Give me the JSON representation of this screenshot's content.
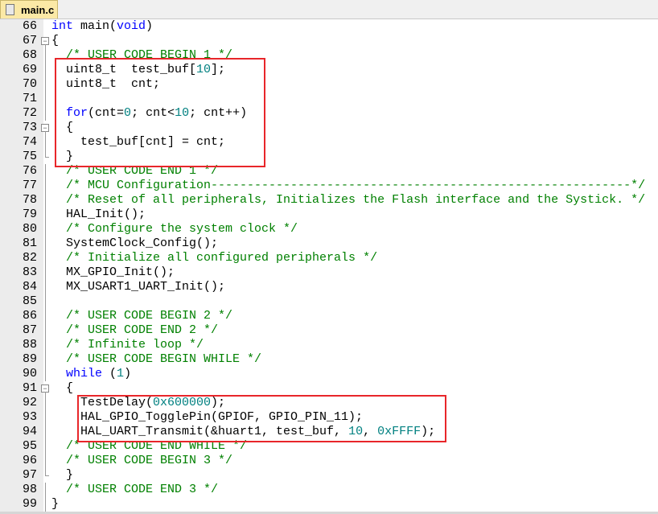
{
  "tab": {
    "title": "main.c",
    "icon": "c-file-icon"
  },
  "colors": {
    "keyword": "#0000ff",
    "comment": "#008000",
    "number": "#008080",
    "highlight_box": "#e8262a"
  },
  "lines": [
    {
      "n": "66",
      "fold": "",
      "t": [
        [
          "kw",
          "int"
        ],
        [
          "pl",
          " main("
        ],
        [
          "kw",
          "void"
        ],
        [
          "pl",
          ")"
        ]
      ]
    },
    {
      "n": "67",
      "fold": "open",
      "t": [
        [
          "pl",
          "{"
        ]
      ]
    },
    {
      "n": "68",
      "fold": "v",
      "t": [
        [
          "cm",
          "  /* USER CODE BEGIN 1 */"
        ]
      ]
    },
    {
      "n": "69",
      "fold": "v",
      "t": [
        [
          "pl",
          "  uint8_t  test_buf["
        ],
        [
          "num",
          "10"
        ],
        [
          "pl",
          "];"
        ]
      ]
    },
    {
      "n": "70",
      "fold": "v",
      "t": [
        [
          "pl",
          "  uint8_t  cnt;"
        ]
      ]
    },
    {
      "n": "71",
      "fold": "v",
      "t": [
        [
          "pl",
          ""
        ]
      ]
    },
    {
      "n": "72",
      "fold": "v",
      "t": [
        [
          "pl",
          "  "
        ],
        [
          "kw",
          "for"
        ],
        [
          "pl",
          "(cnt="
        ],
        [
          "num",
          "0"
        ],
        [
          "pl",
          "; cnt<"
        ],
        [
          "num",
          "10"
        ],
        [
          "pl",
          "; cnt++)"
        ]
      ]
    },
    {
      "n": "73",
      "fold": "open",
      "t": [
        [
          "pl",
          "  {"
        ]
      ]
    },
    {
      "n": "74",
      "fold": "v",
      "t": [
        [
          "pl",
          "    test_buf[cnt] = cnt;"
        ]
      ]
    },
    {
      "n": "75",
      "fold": "end",
      "t": [
        [
          "pl",
          "  }"
        ]
      ]
    },
    {
      "n": "76",
      "fold": "v",
      "t": [
        [
          "cm",
          "  /* USER CODE END 1 */"
        ]
      ]
    },
    {
      "n": "77",
      "fold": "v",
      "t": [
        [
          "cm",
          "  /* MCU Configuration----------------------------------------------------------*/"
        ]
      ]
    },
    {
      "n": "78",
      "fold": "v",
      "t": [
        [
          "cm",
          "  /* Reset of all peripherals, Initializes the Flash interface and the Systick. */"
        ]
      ]
    },
    {
      "n": "79",
      "fold": "v",
      "t": [
        [
          "pl",
          "  HAL_Init();"
        ]
      ]
    },
    {
      "n": "80",
      "fold": "v",
      "t": [
        [
          "cm",
          "  /* Configure the system clock */"
        ]
      ]
    },
    {
      "n": "81",
      "fold": "v",
      "t": [
        [
          "pl",
          "  SystemClock_Config();"
        ]
      ]
    },
    {
      "n": "82",
      "fold": "v",
      "t": [
        [
          "cm",
          "  /* Initialize all configured peripherals */"
        ]
      ]
    },
    {
      "n": "83",
      "fold": "v",
      "t": [
        [
          "pl",
          "  MX_GPIO_Init();"
        ]
      ]
    },
    {
      "n": "84",
      "fold": "v",
      "t": [
        [
          "pl",
          "  MX_USART1_UART_Init();"
        ]
      ]
    },
    {
      "n": "85",
      "fold": "v",
      "t": [
        [
          "pl",
          ""
        ]
      ]
    },
    {
      "n": "86",
      "fold": "v",
      "t": [
        [
          "cm",
          "  /* USER CODE BEGIN 2 */"
        ]
      ]
    },
    {
      "n": "87",
      "fold": "v",
      "t": [
        [
          "cm",
          "  /* USER CODE END 2 */"
        ]
      ]
    },
    {
      "n": "88",
      "fold": "v",
      "t": [
        [
          "cm",
          "  /* Infinite loop */"
        ]
      ]
    },
    {
      "n": "89",
      "fold": "v",
      "t": [
        [
          "cm",
          "  /* USER CODE BEGIN WHILE */"
        ]
      ]
    },
    {
      "n": "90",
      "fold": "v",
      "t": [
        [
          "pl",
          "  "
        ],
        [
          "kw",
          "while"
        ],
        [
          "pl",
          " ("
        ],
        [
          "num",
          "1"
        ],
        [
          "pl",
          ")"
        ]
      ]
    },
    {
      "n": "91",
      "fold": "open",
      "t": [
        [
          "pl",
          "  {"
        ]
      ]
    },
    {
      "n": "92",
      "fold": "v",
      "t": [
        [
          "pl",
          "    TestDelay("
        ],
        [
          "num",
          "0x600000"
        ],
        [
          "pl",
          ");"
        ]
      ]
    },
    {
      "n": "93",
      "fold": "v",
      "t": [
        [
          "pl",
          "    HAL_GPIO_TogglePin(GPIOF, GPIO_PIN_11);"
        ]
      ]
    },
    {
      "n": "94",
      "fold": "v",
      "t": [
        [
          "pl",
          "    HAL_UART_Transmit(&huart1, test_buf, "
        ],
        [
          "num",
          "10"
        ],
        [
          "pl",
          ", "
        ],
        [
          "num",
          "0xFFFF"
        ],
        [
          "pl",
          ");"
        ]
      ]
    },
    {
      "n": "95",
      "fold": "v",
      "t": [
        [
          "cm",
          "  /* USER CODE END WHILE */"
        ]
      ]
    },
    {
      "n": "96",
      "fold": "v",
      "t": [
        [
          "cm",
          "  /* USER CODE BEGIN 3 */"
        ]
      ]
    },
    {
      "n": "97",
      "fold": "end",
      "t": [
        [
          "pl",
          "  }"
        ]
      ]
    },
    {
      "n": "98",
      "fold": "v",
      "t": [
        [
          "cm",
          "  /* USER CODE END 3 */"
        ]
      ]
    },
    {
      "n": "99",
      "fold": "v",
      "t": [
        [
          "pl",
          "}"
        ]
      ]
    }
  ]
}
